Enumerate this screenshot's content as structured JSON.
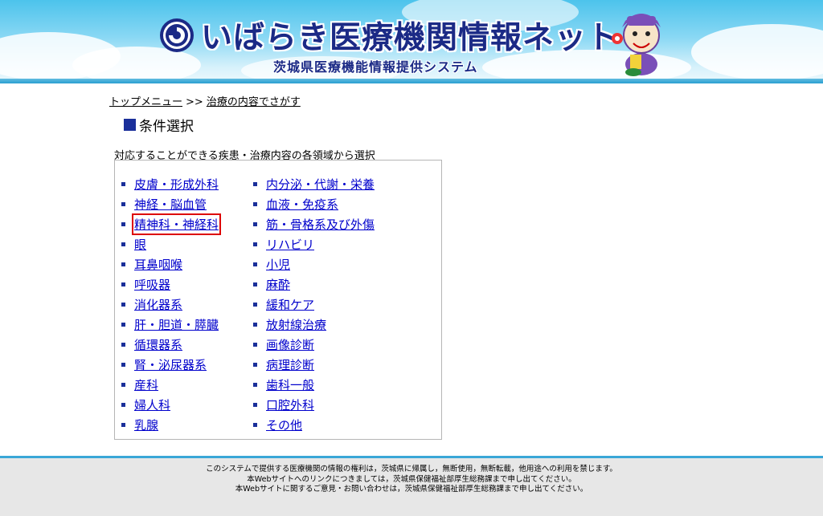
{
  "header": {
    "site_title": "いばらき医療機関情報ネット",
    "site_subtitle": "茨城県医療機能情報提供システム",
    "colors": {
      "title": "#1b2a86",
      "sky": "#4cc3ec"
    },
    "logo_icon": "swirl-logo-icon",
    "mascot": "mascot-character-image"
  },
  "breadcrumb": {
    "home": "トップメニュー",
    "separator": ">>",
    "current": "治療の内容でさがす"
  },
  "section": {
    "heading": "条件選択",
    "instruction": "対応することができる疾患・治療内容の各領域から選択"
  },
  "categories": {
    "left": [
      "皮膚・形成外科",
      "神経・脳血管",
      "精神科・神経科",
      "眼",
      "耳鼻咽喉",
      "呼吸器",
      "消化器系",
      "肝・胆道・膵臓",
      "循環器系",
      "腎・泌尿器系",
      "産科",
      "婦人科",
      "乳腺"
    ],
    "right": [
      "内分泌・代謝・栄養",
      "血液・免疫系",
      "筋・骨格系及び外傷",
      "リハビリ",
      "小児",
      "麻酔",
      "緩和ケア",
      "放射線治療",
      "画像診断",
      "病理診断",
      "歯科一般",
      "口腔外科",
      "その他"
    ],
    "selected": "精神科・神経科",
    "colors": {
      "link": "#0000cc",
      "highlight": "#dd0000",
      "bullet": "#1a2f9a"
    }
  },
  "footer": {
    "line1": "このシステムで提供する医療機関の情報の権利は，茨城県に帰属し，無断使用，無断転載，他用途への利用を禁じます。",
    "line2": "本Webサイトへのリンクにつきましては，茨城県保健福祉部厚生総務課まで申し出てください。",
    "line3": "本Webサイトに関するご意見・お問い合わせは，茨城県保健福祉部厚生総務課まで申し出てください。"
  }
}
